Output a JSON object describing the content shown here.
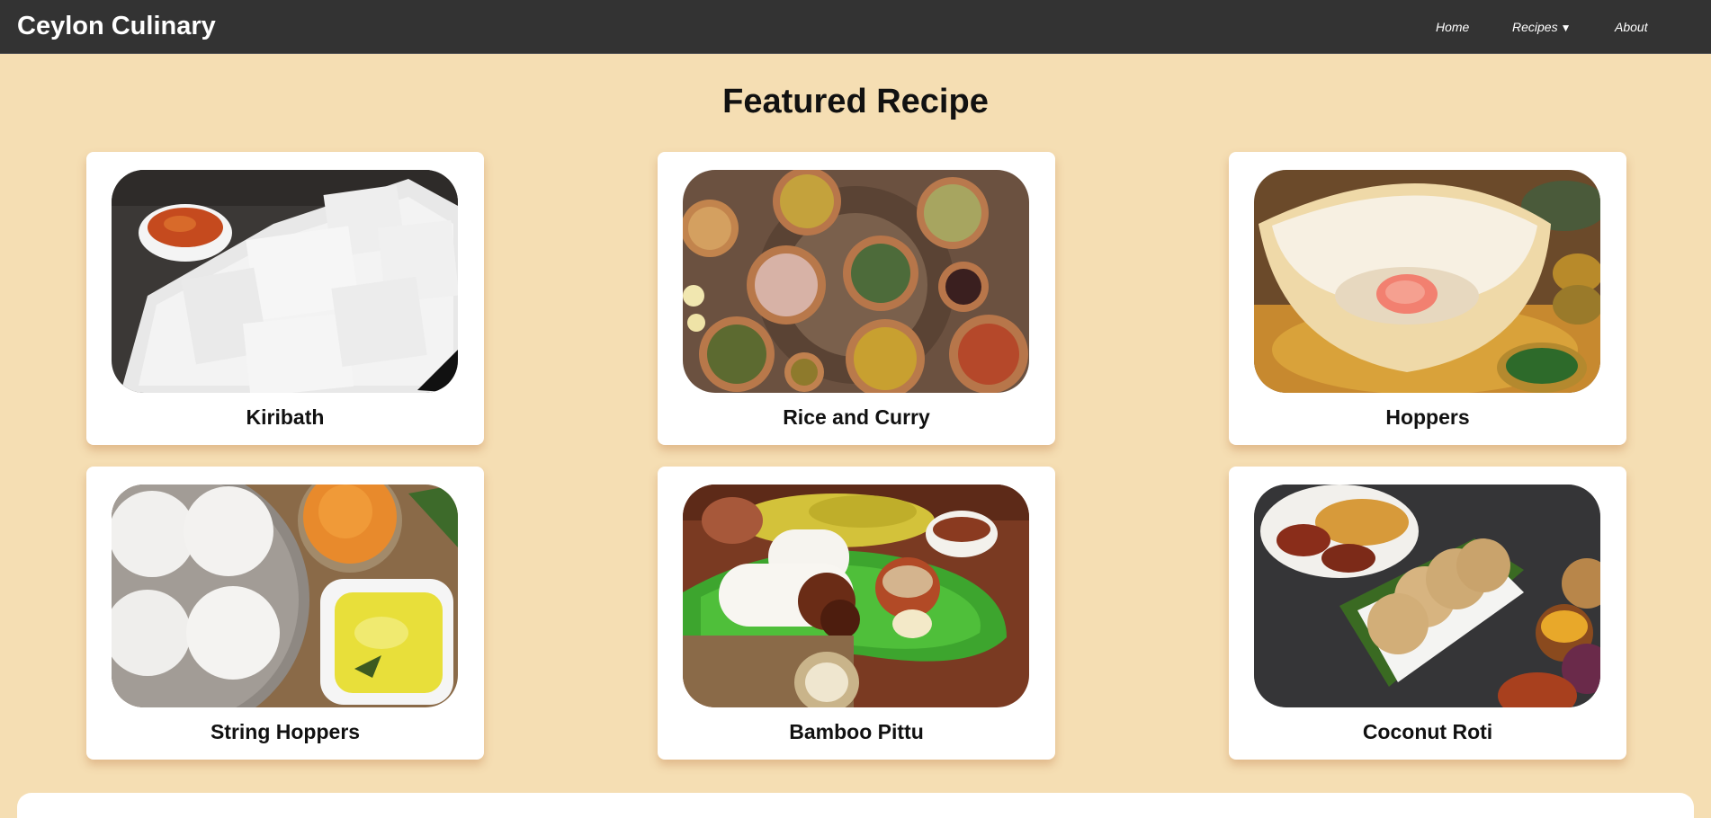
{
  "brand": "Ceylon Culinary",
  "nav": {
    "home": "Home",
    "recipes": "Recipes",
    "recipes_caret": "▼",
    "about": "About"
  },
  "page_title": "Featured Recipe",
  "recipes": [
    {
      "name": "Kiribath"
    },
    {
      "name": "Rice and Curry"
    },
    {
      "name": "Hoppers"
    },
    {
      "name": "String Hoppers"
    },
    {
      "name": "Bamboo Pittu"
    },
    {
      "name": "Coconut Roti"
    }
  ],
  "colors": {
    "navbar": "#333333",
    "background": "#f5deb3",
    "card": "#ffffff"
  }
}
